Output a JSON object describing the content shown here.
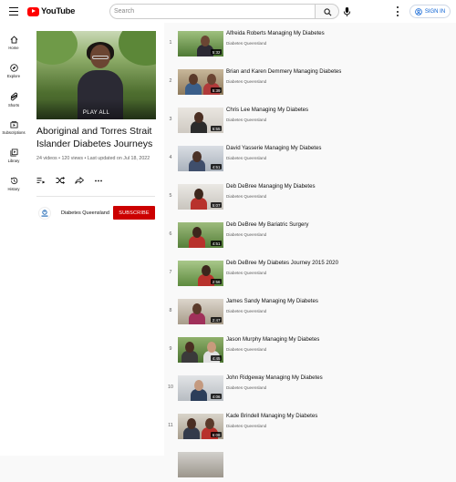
{
  "header": {
    "logo_text": "YouTube",
    "search_placeholder": "Search",
    "signin_label": "SIGN IN",
    "colors": {
      "brand": "#ff0000",
      "link": "#065fd4"
    }
  },
  "sidebar": {
    "items": [
      {
        "label": "Home",
        "icon": "home-icon"
      },
      {
        "label": "Explore",
        "icon": "compass-icon"
      },
      {
        "label": "Shorts",
        "icon": "shorts-icon"
      },
      {
        "label": "Subscriptions",
        "icon": "subscriptions-icon"
      },
      {
        "label": "Library",
        "icon": "library-icon"
      },
      {
        "label": "History",
        "icon": "history-icon"
      }
    ]
  },
  "playlist": {
    "play_all_label": "PLAY ALL",
    "title": "Aboriginal and Torres Strait Islander Diabetes Journeys",
    "meta": "24 videos • 120 views • Last updated on Jul 18, 2022",
    "channel_name": "Diabetes Queensland",
    "subscribe_label": "SUBSCRIBE",
    "subscribe_color": "#cc0000"
  },
  "videos": [
    {
      "index": "1",
      "title": "Alfreida Roberts Managing My Diabetes",
      "channel": "Diabetes Queensland",
      "duration": "5:32"
    },
    {
      "index": "2",
      "title": "Brian and Karen Demmery Managing Diabetes",
      "channel": "Diabetes Queensland",
      "duration": "5:39"
    },
    {
      "index": "3",
      "title": "Chris Lee Managing My Diabetes",
      "channel": "Diabetes Queensland",
      "duration": "6:55"
    },
    {
      "index": "4",
      "title": "David Yasserie Managing My Diabetes",
      "channel": "Diabetes Queensland",
      "duration": "4:51"
    },
    {
      "index": "5",
      "title": "Deb DeBree Managing My Diabetes",
      "channel": "Diabetes Queensland",
      "duration": "5:07"
    },
    {
      "index": "6",
      "title": "Deb DeBree My Bariatric Surgery",
      "channel": "Diabetes Queensland",
      "duration": "4:51"
    },
    {
      "index": "7",
      "title": "Deb DeBree My Diabetes Journey 2015 2020",
      "channel": "Diabetes Queensland",
      "duration": "2:56"
    },
    {
      "index": "8",
      "title": "James Sandy Managing My Diabetes",
      "channel": "Diabetes Queensland",
      "duration": "2:47"
    },
    {
      "index": "9",
      "title": "Jason Murphy Managing My Diabetes",
      "channel": "Diabetes Queensland",
      "duration": "4:45"
    },
    {
      "index": "10",
      "title": "John Ridgeway Managing My Diabetes",
      "channel": "Diabetes Queensland",
      "duration": "4:06"
    },
    {
      "index": "11",
      "title": "Kade Brindell Managing My Diabetes",
      "channel": "Diabetes Queensland",
      "duration": "6:08"
    }
  ]
}
